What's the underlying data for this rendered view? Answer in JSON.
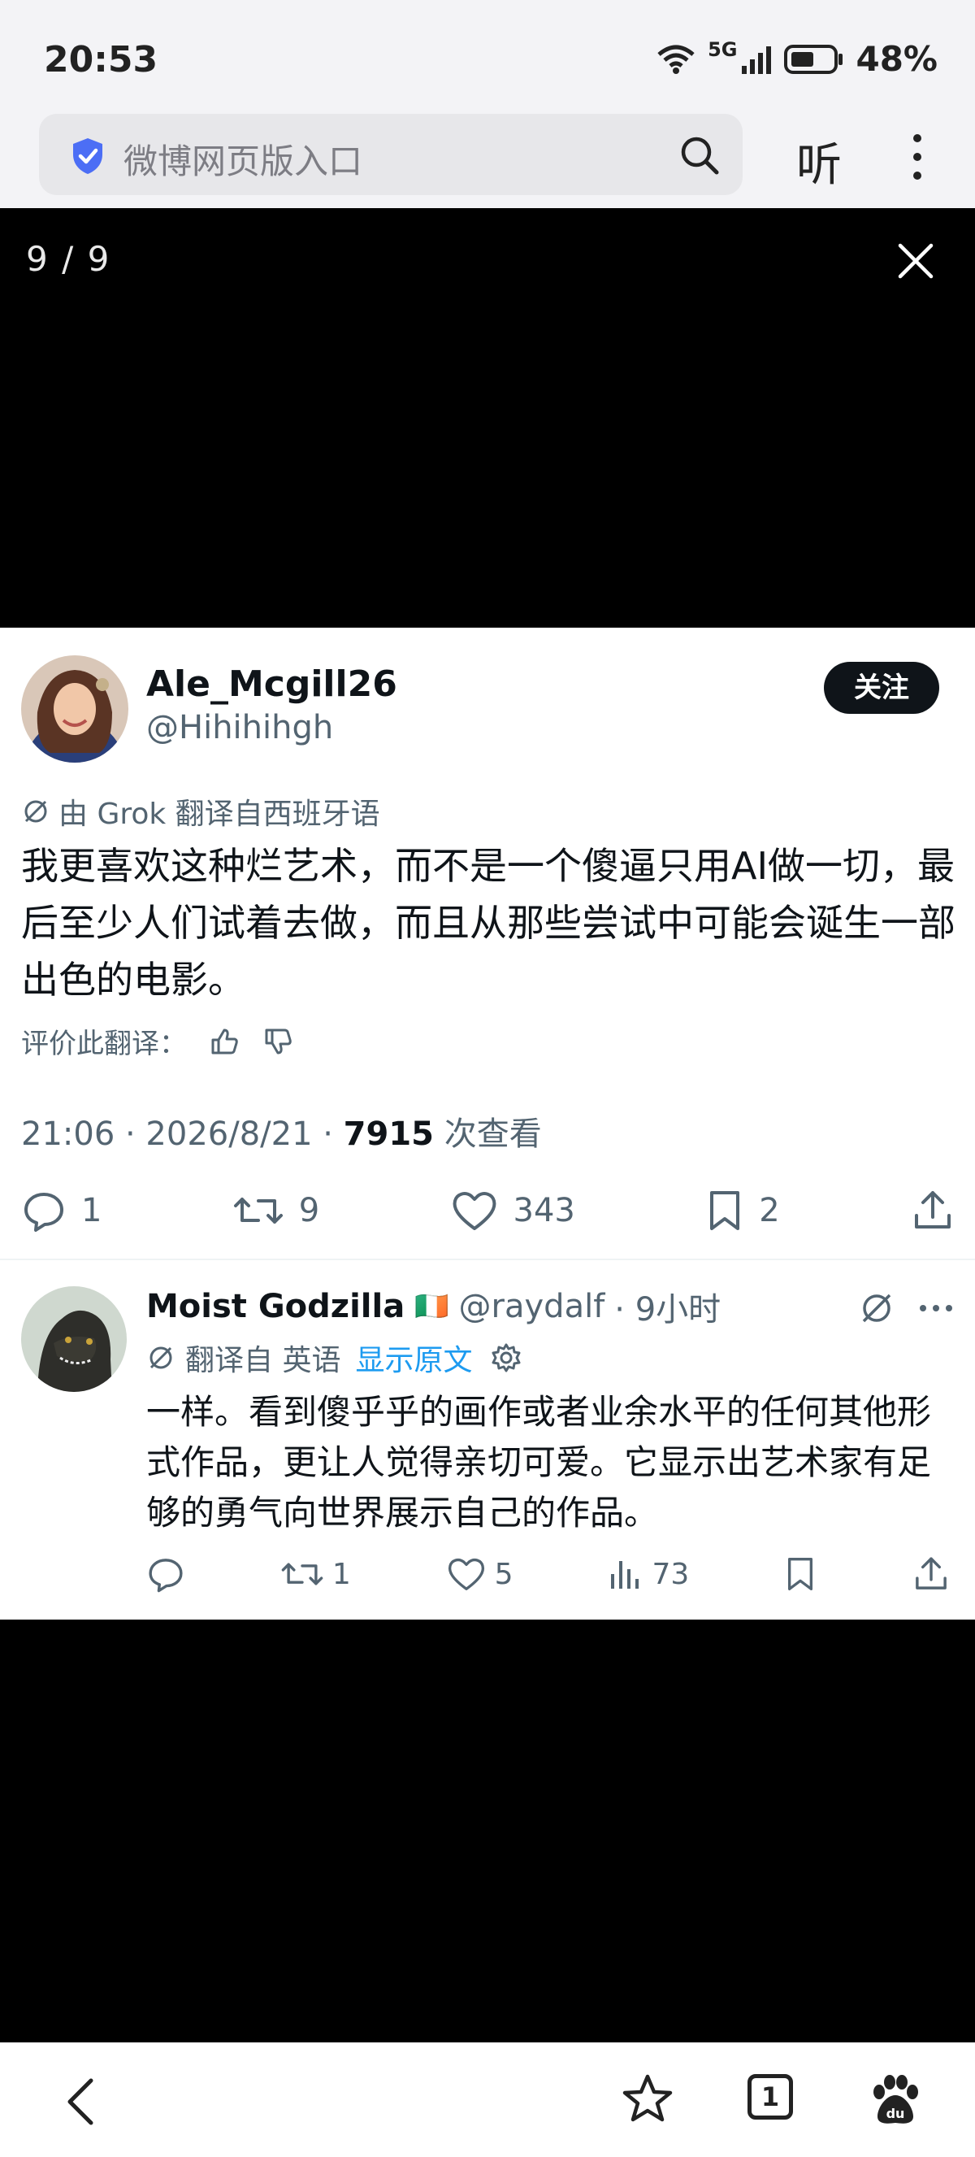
{
  "status_bar": {
    "time": "20:53",
    "network": "5G",
    "battery": "48%"
  },
  "browser": {
    "address_text": "微博网页版入口",
    "listen_label": "听"
  },
  "viewer": {
    "counter": "9 / 9"
  },
  "tweet": {
    "author_name": "Ale_Mcgill26",
    "author_handle": "@Hihihihgh",
    "follow_label": "关注",
    "translation_note": "由 Grok 翻译自西班牙语",
    "text": "我更喜欢这种烂艺术，而不是一个傻逼只用AI做一切，最后至少人们试着去做，而且从那些尝试中可能会诞生一部出色的电影。",
    "rate_label": "评价此翻译：",
    "meta_time": "21:06 · 2026/8/21 · ",
    "views_count": "7915",
    "views_label": " 次查看",
    "actions": {
      "replies": "1",
      "reposts": "9",
      "likes": "343",
      "bookmarks": "2"
    }
  },
  "reply": {
    "author_name": "Moist Godzilla",
    "flag": "🇮🇪",
    "author_handle": "@raydalf",
    "time": "· 9小时",
    "translated_from": "翻译自 英语",
    "show_original": "显示原文",
    "text": "一样。看到傻乎乎的画作或者业余水平的任何其他形式作品，更让人觉得亲切可爱。它显示出艺术家有足够的勇气向世界展示自己的作品。",
    "actions": {
      "reposts": "1",
      "likes": "5",
      "views": "73"
    }
  },
  "bottom_nav": {
    "tabs_count": "1"
  }
}
